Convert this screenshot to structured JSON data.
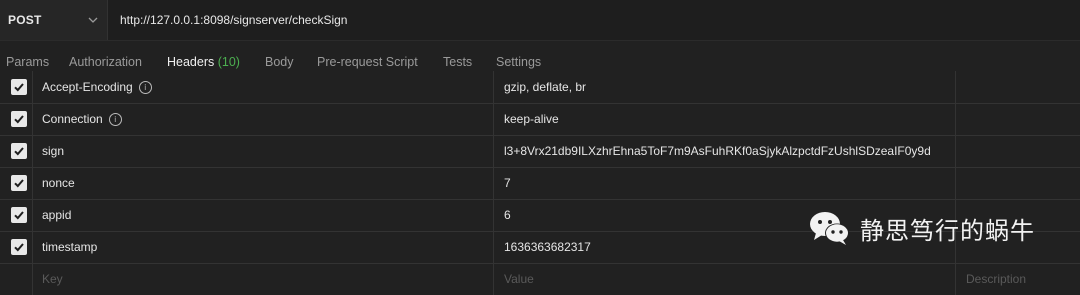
{
  "request": {
    "method": "POST",
    "url": "http://127.0.0.1:8098/signserver/checkSign"
  },
  "tabs": [
    {
      "label": "Params"
    },
    {
      "label": "Authorization"
    },
    {
      "label": "Headers",
      "count": "(10)",
      "active": true
    },
    {
      "label": "Body"
    },
    {
      "label": "Pre-request Script"
    },
    {
      "label": "Tests"
    },
    {
      "label": "Settings"
    }
  ],
  "headers": [
    {
      "key": "Accept-Encoding",
      "value": "gzip, deflate, br",
      "checked": true,
      "info": true
    },
    {
      "key": "Connection",
      "value": "keep-alive",
      "checked": true,
      "info": true
    },
    {
      "key": "sign",
      "value": "l3+8Vrx21db9ILXzhrEhna5ToF7m9AsFuhRKf0aSjykAlzpctdFzUshlSDzeaIF0y9d",
      "checked": true
    },
    {
      "key": "nonce",
      "value": "7",
      "checked": true
    },
    {
      "key": "appid",
      "value": "6",
      "checked": true
    },
    {
      "key": "timestamp",
      "value": "1636363682317",
      "checked": true
    }
  ],
  "placeholder": {
    "key": "Key",
    "value": "Value",
    "description": "Description"
  },
  "watermark": {
    "text": "静思笃行的蜗牛"
  },
  "colors": {
    "accent": "#f26b3a",
    "count": "#4caf50"
  },
  "icons": {
    "method_dropdown": "chevron-down-icon",
    "info": "info-icon",
    "checkbox": "checkbox-checked-icon",
    "watermark_logo": "wechat-logo"
  }
}
